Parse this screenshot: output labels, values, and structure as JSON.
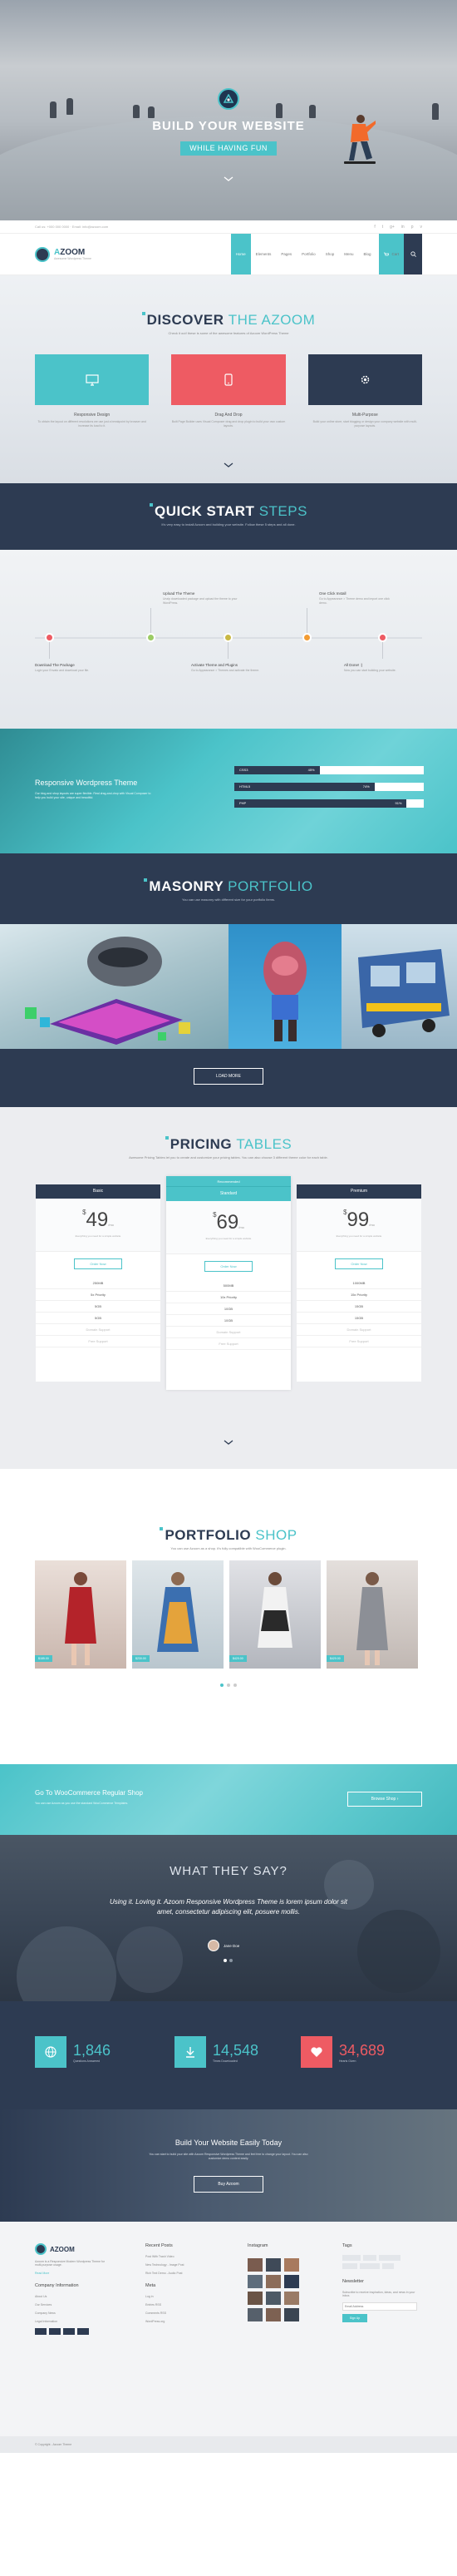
{
  "hero": {
    "title": "BUILD YOUR WEBSITE",
    "tagline": "WHILE HAVING FUN"
  },
  "topbar": {
    "contact": "Call us: +000 000 0000 · Email: info@azoom.com",
    "social": [
      "f",
      "t",
      "g+",
      "in",
      "p",
      "v"
    ]
  },
  "nav": {
    "logo": "AZOOM",
    "logo_lead": "A",
    "logo_rest": "ZOOM",
    "logo_sub": "Awesome Wordpress Theme",
    "menu": [
      "Home",
      "Elements",
      "Pages",
      "Portfolio",
      "Shop",
      "Menu",
      "Blog"
    ],
    "cart": "Cart"
  },
  "discover": {
    "title_a": "DISCOVER",
    "title_b": "THE AZOOM",
    "subtitle": "Check it out! these is some of the awesome features of Azoom WordPress Theme",
    "features": [
      {
        "title": "Responsive Design",
        "desc": "To obtain the layout on different resolutions we use just a breakpoint by browser and increase its load to it.",
        "icon": "monitor-icon",
        "color": "#4bc3c9"
      },
      {
        "title": "Drag And Drop",
        "desc": "Built Page Builder uses Visual Composer drag and drop plugin to build your own custom layouts.",
        "icon": "phone-icon",
        "color": "#ee5b63"
      },
      {
        "title": "Multi-Purpose",
        "desc": "Build your online store, start blogging or design your company website with multi-purpose layouts.",
        "icon": "gear-icon",
        "color": "#2d3b52"
      }
    ]
  },
  "quick": {
    "title_a": "QUICK START",
    "title_b": "STEPS",
    "subtitle": "It's very easy to install Azoom and building your website. Follow these 5 steps and all done."
  },
  "steps": [
    {
      "title": "Download The Package",
      "desc": "Login your Envato and download your file.",
      "color": "#ee5b63"
    },
    {
      "title": "Upload The Theme",
      "desc": "Unzip downloaded package and upload the theme to your WordPress.",
      "color": "#9ccc65"
    },
    {
      "title": "Activate Theme and Plugins",
      "desc": "Go to Appearance > Themes and activate the theme.",
      "color": "#c9b945"
    },
    {
      "title": "One Click Install",
      "desc": "Go to Appearance > Theme demo and import one click demo.",
      "color": "#f39c33"
    },
    {
      "title": "All Done! :)",
      "desc": "Now you can start building your website.",
      "color": "#ee5b63"
    }
  ],
  "skills": {
    "title": "Responsive Wordpress Theme",
    "desc": "Our blog and shop layouts are super flexible. Real drag-and-drop with Visual Composer to help you build your site, unique and beautiful.",
    "bars": [
      {
        "name": "CSS3",
        "value": 45
      },
      {
        "name": "HTML5",
        "value": 74
      },
      {
        "name": "PHP",
        "value": 91
      }
    ]
  },
  "masonry": {
    "title_a": "MASONRY",
    "title_b": "PORTFOLIO",
    "subtitle": "You can use masonry with different size for your portfolio items.",
    "button": "LOAD MORE"
  },
  "pricing": {
    "title_a": "PRICING",
    "title_b": "TABLES",
    "subtitle": "Awesome Pricing Tables let you to create and customize your pricing tables. You can also choose 3 different theme color for each table.",
    "order": "Order Now",
    "recommended": "Recommended",
    "plans": [
      {
        "name": "Basic",
        "price": "49",
        "per": "/mo",
        "desc": "Everything you need for a simple website",
        "rows": [
          "250MB",
          "5x Priority",
          "5GB",
          "5GB"
        ],
        "off": [
          "Domain Support",
          "Free Support"
        ]
      },
      {
        "name": "Standard",
        "price": "69",
        "per": "/mo",
        "desc": "Everything you need for a simple website",
        "rows": [
          "500MB",
          "10x Priority",
          "10GB",
          "10GB"
        ],
        "off": [
          "Domain Support",
          "Free Support"
        ]
      },
      {
        "name": "Premium",
        "price": "99",
        "per": "/mo",
        "desc": "Everything you need for a simple website",
        "rows": [
          "1000MB",
          "15x Priority",
          "15GB",
          "15GB"
        ],
        "off": [
          "Domain Support",
          "Free Support"
        ]
      }
    ]
  },
  "shop": {
    "title_a": "PORTFOLIO",
    "title_b": "SHOP",
    "subtitle": "You can use Azoom as a shop. it's fully compatible with WooCommerce plugin.",
    "products": [
      "$185.00",
      "$230.00",
      "$420.00",
      "$420.00"
    ]
  },
  "woo": {
    "title": "Go To WooCommerce Regular Shop",
    "desc": "You can use Azoom as you use the standard WooCommerce Templates.",
    "button": "Browse Shop"
  },
  "testi": {
    "title": "WHAT THEY SAY?",
    "quote": "Using it. Loving it. Azoom Responsive Wordpress Theme is lorem ipsum dolor sit amet, consectetur adipiscing elit, posuere mollis.",
    "author": "Jane Doe"
  },
  "stats": [
    {
      "value": "1,846",
      "label": "Questions Answered",
      "color": "#4bc3c9",
      "icon": "globe-icon"
    },
    {
      "value": "14,548",
      "label": "Times Downloaded",
      "color": "#4bc3c9",
      "icon": "download-icon"
    },
    {
      "value": "34,689",
      "label": "Hearts Given",
      "color": "#ee5b63",
      "icon": "heart-icon"
    }
  ],
  "cta": {
    "title": "Build Your Website Easily Today",
    "desc": "You can start to build your site with Azoom Responsive Wordpress Theme and feel free to change your layout. You can also customize demo content easily.",
    "button": "Buy Azoom"
  },
  "footer": {
    "about": "Azoom is a Responsive Modern Wordpress Theme for multi-purpose usage.",
    "read": "Read More",
    "info_title": "Company Information",
    "info": [
      "About Us",
      "Our Services",
      "Company News",
      "Legal Information"
    ],
    "recent_title": "Recent Posts",
    "recent": [
      "Post With Trash Video",
      "New Technology - Image Post",
      "Rich Text Demo - Audio Post"
    ],
    "meta_title": "Meta",
    "meta": [
      "Log in",
      "Entries RSS",
      "Comments RSS",
      "WordPress.org"
    ],
    "insta_title": "Instagram",
    "tags_title": "Tags",
    "newsletter_title": "Newsletter",
    "newsletter_desc": "Subscribe to receive inspiration, ideas, and news in your inbox.",
    "email_placeholder": "Email Address",
    "signup": "Sign Up"
  },
  "copyright": "© Copyright - Azoom Theme"
}
